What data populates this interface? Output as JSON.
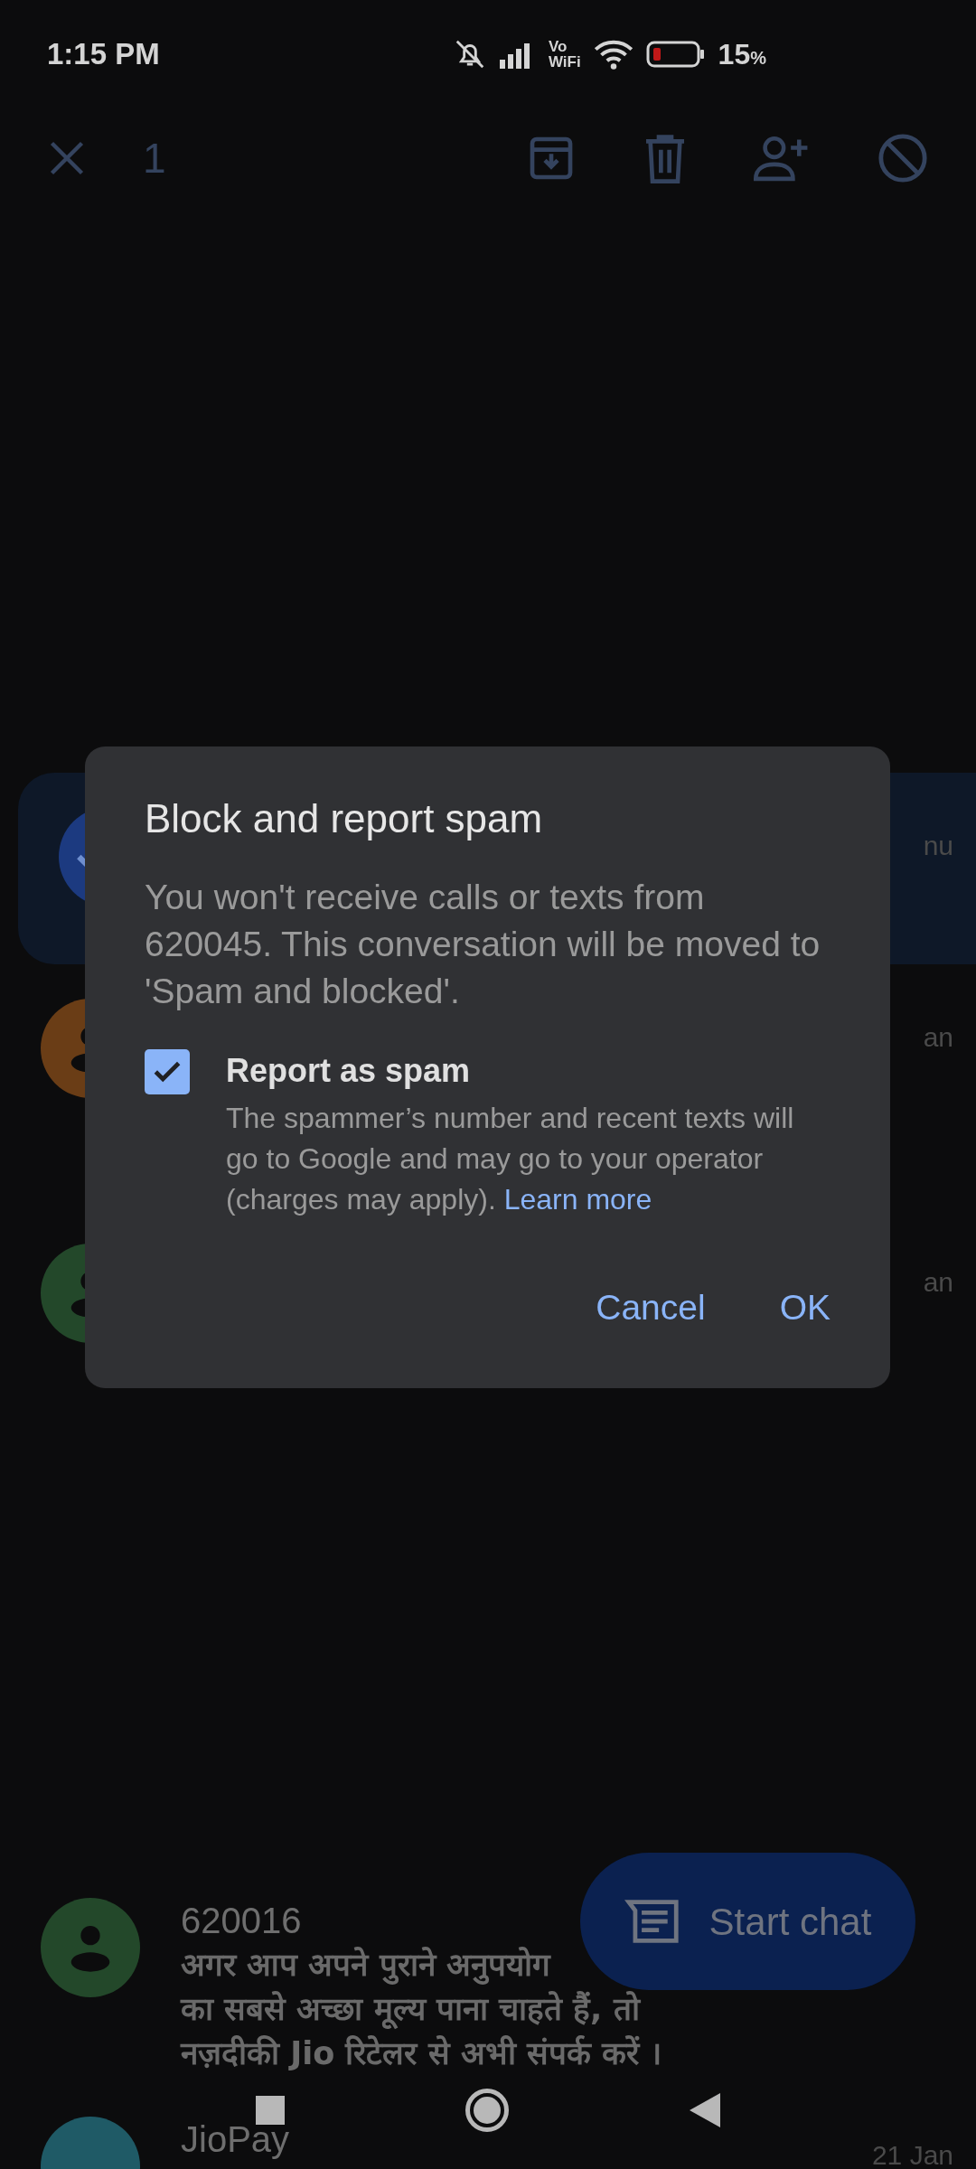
{
  "status_bar": {
    "time": "1:15 PM",
    "vowifi": [
      "Vo",
      "WiFi"
    ],
    "battery_percent": "15",
    "battery_unit": "%"
  },
  "toolbar": {
    "selected_count": "1"
  },
  "conversations": [
    {
      "color": "#1c3a80",
      "selected": true,
      "date": "nu"
    },
    {
      "color": "#6a3d16",
      "selected": false,
      "date": "an"
    },
    {
      "color": "#23482a",
      "selected": false,
      "date": "an"
    },
    {
      "color": "#23482a",
      "selected": false,
      "name": "620016",
      "snippet": [
        "अगर आप अपने पुराने अनुपयोग",
        "का सबसे अच्छा मूल्य पाना चाहते हैं, तो",
        "नज़दीकी  Jio रिटेलर से अभी संपर्क करें ।"
      ]
    },
    {
      "color": "#1f5a66",
      "selected": false,
      "name": "JioPay",
      "date": "21 Jan"
    }
  ],
  "fab": {
    "label": "Start chat"
  },
  "dialog": {
    "title": "Block and report spam",
    "message": "You won't receive calls or texts from 620045. This conversation will be moved to 'Spam and blocked'.",
    "checkbox": {
      "label": "Report as spam",
      "checked": true,
      "description": "The spammer’s number and recent texts will go to Google and may go to your operator (charges may apply).",
      "link": "Learn more"
    },
    "buttons": [
      "Cancel",
      "OK"
    ]
  }
}
